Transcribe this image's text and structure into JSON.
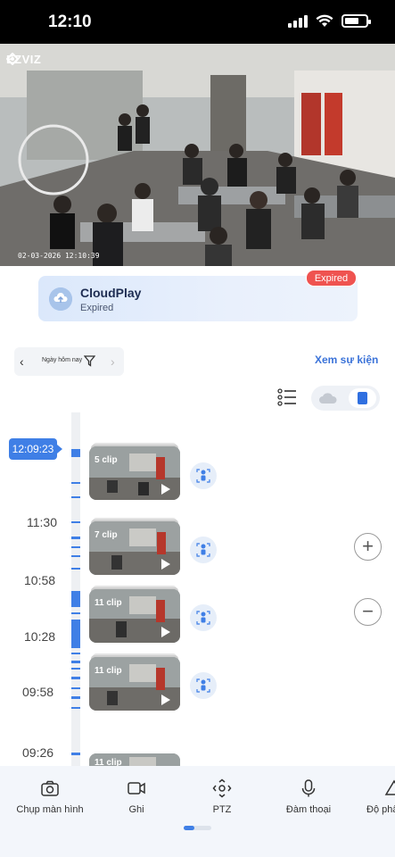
{
  "status_bar": {
    "time": "12:10"
  },
  "camera": {
    "brand": "EZVIZ",
    "timestamp": "02-03-2026 12:10:39"
  },
  "cloudplay": {
    "title": "CloudPlay",
    "subtitle": "Expired",
    "badge": "Expired"
  },
  "date_selector": {
    "label": "Ngày hôm nay"
  },
  "events_link": "Xem sự kiện",
  "timeline": {
    "current_time": "12:09:23",
    "labels": [
      "11:30",
      "10:58",
      "10:28",
      "09:58",
      "09:26"
    ]
  },
  "clips": [
    {
      "count": "5 clip"
    },
    {
      "count": "7 clip"
    },
    {
      "count": "11 clip"
    },
    {
      "count": "11 clip"
    },
    {
      "count": "11 clip"
    }
  ],
  "zoom": {
    "in": "+",
    "out": "−"
  },
  "toolbar": [
    {
      "label": "Chụp màn hình",
      "icon": "camera-icon"
    },
    {
      "label": "Ghi",
      "icon": "record-icon"
    },
    {
      "label": "PTZ",
      "icon": "ptz-icon"
    },
    {
      "label": "Đàm thoại",
      "icon": "microphone-icon"
    },
    {
      "label": "Độ phân",
      "icon": "resolution-icon"
    }
  ],
  "colors": {
    "accent": "#3f7fe6",
    "badge": "#ef5350",
    "link": "#3b73d9"
  }
}
